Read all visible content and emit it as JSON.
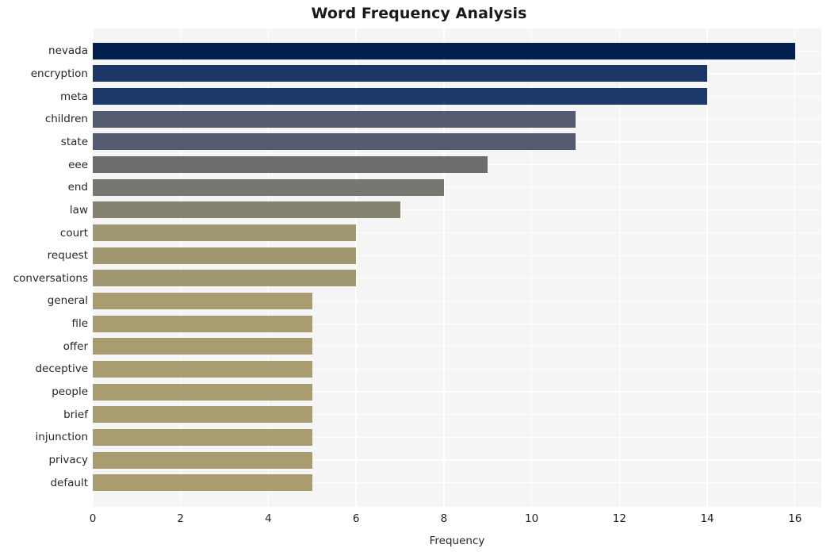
{
  "chart_data": {
    "type": "bar",
    "orientation": "horizontal",
    "title": "Word Frequency Analysis",
    "xlabel": "Frequency",
    "ylabel": "",
    "xlim": [
      0,
      16.6
    ],
    "xticks": [
      0,
      2,
      4,
      6,
      8,
      10,
      12,
      14,
      16
    ],
    "xtick_labels": [
      "0",
      "2",
      "4",
      "6",
      "8",
      "10",
      "12",
      "14",
      "16"
    ],
    "grid": true,
    "legend": "none",
    "background": "#f5f5f6",
    "gridline_color": "#ffffff",
    "categories": [
      "nevada",
      "encryption",
      "meta",
      "children",
      "state",
      "eee",
      "end",
      "law",
      "court",
      "request",
      "conversations",
      "general",
      "file",
      "offer",
      "deceptive",
      "people",
      "brief",
      "injunction",
      "privacy",
      "default"
    ],
    "values": [
      16,
      14,
      14,
      11,
      11,
      9,
      8,
      7,
      6,
      6,
      6,
      5,
      5,
      5,
      5,
      5,
      5,
      5,
      5,
      5
    ],
    "bar_colors": [
      "#02204e",
      "#1c3668",
      "#1d386b",
      "#545a70",
      "#555b71",
      "#6c6c6e",
      "#777772",
      "#85826f",
      "#a09871",
      "#a09871",
      "#a09871",
      "#a99d70",
      "#a99d70",
      "#a99d70",
      "#a99d70",
      "#a99d70",
      "#a99d70",
      "#a99d70",
      "#a99d70",
      "#a99d70"
    ]
  }
}
